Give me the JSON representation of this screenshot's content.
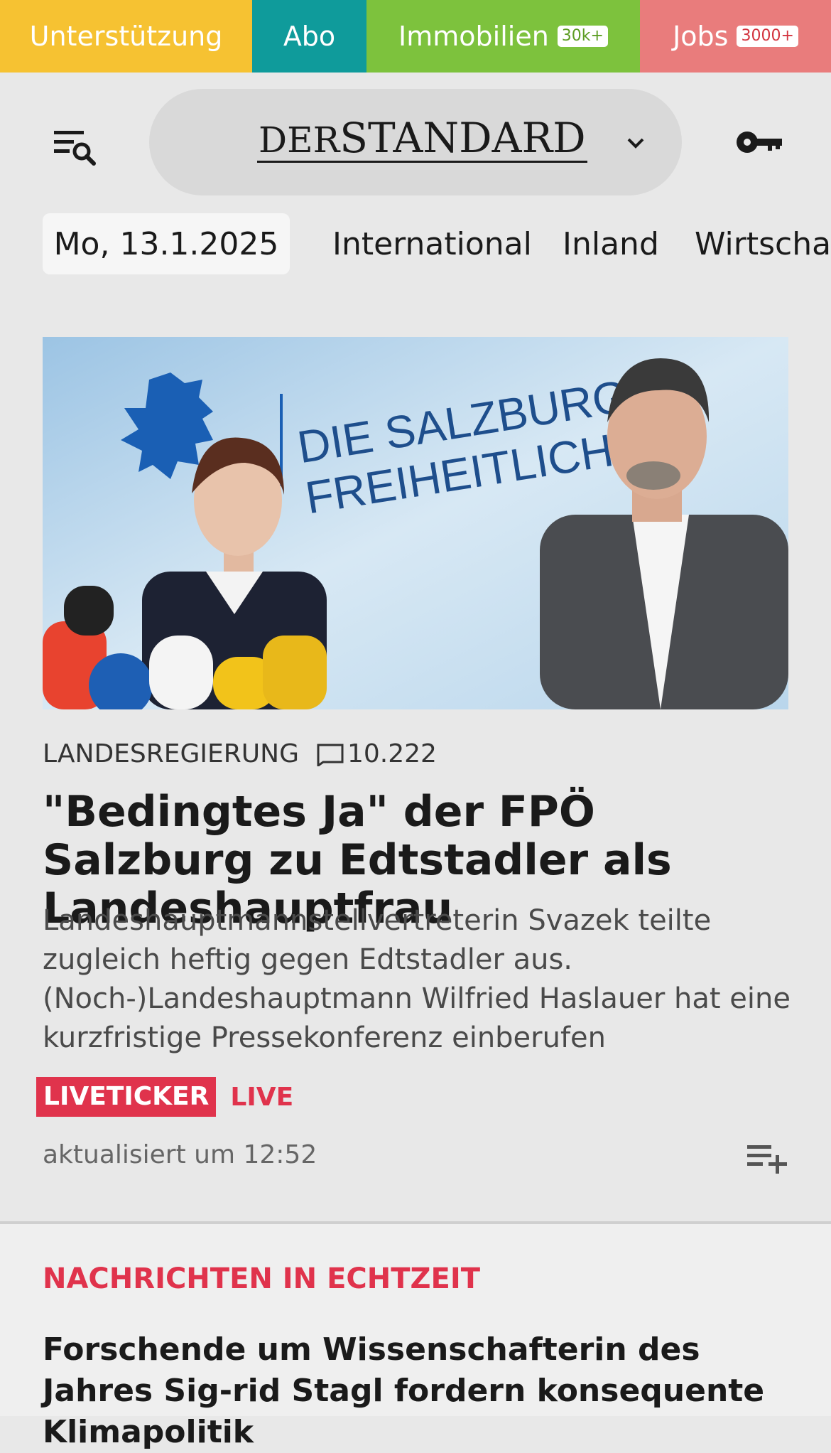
{
  "topbar": {
    "support": "Unterstützung",
    "abo": "Abo",
    "immobilien": "Immobilien",
    "immobilien_badge": "30k+",
    "jobs": "Jobs",
    "jobs_badge": "3000+"
  },
  "header": {
    "logo_der": "DER",
    "logo_standard": "STANDARD"
  },
  "nav": {
    "date": "Mo, 13.1.2025",
    "items": [
      "International",
      "Inland",
      "Wirtschaft"
    ]
  },
  "hero": {
    "backdrop_line1": "DIE SALZBURGER",
    "backdrop_line2": "FREIHEITLICHEN"
  },
  "article": {
    "kicker": "LANDESREGIERUNG",
    "comments": "10.222",
    "headline": "\"Bedingtes Ja\" der FPÖ Salzburg zu Edtstadler als Landeshauptfrau",
    "teaser": "Landeshauptmannstellvertreterin Svazek teilte zugleich heftig gegen Edtstadler aus. (Noch-)Landeshauptmann Wilfried Haslauer hat eine kurzfristige Pressekonferenz einberufen",
    "live_badge": "LIVETICKER",
    "live_text": "LIVE",
    "updated": "aktualisiert um 12:52"
  },
  "section": {
    "title": "NACHRICHTEN IN ECHTZEIT",
    "headline": "Forschende um Wissenschafterin des Jahres Sig-rid Stagl fordern konsequente Klimapolitik"
  },
  "colors": {
    "support": "#f6c232",
    "abo": "#0f9b9b",
    "immobilien": "#7dc23d",
    "jobs": "#e97c7c",
    "live": "#e0334c"
  }
}
